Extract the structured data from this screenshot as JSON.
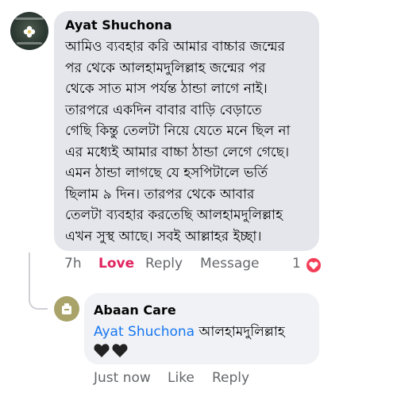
{
  "comment": {
    "author": "Ayat Shuchona",
    "body": "আমিও ব্যবহার করি আমার বাচ্চার জন্মের\nপর থেকে আলহামদুলিল্লাহ জন্মের পর\nথেকে সাত মাস পর্যন্ত ঠান্ডা লাগে নাই।\nতারপরে একদিন বাবার বাড়ি বেড়াতে\nগেছি কিন্তু তেলটা নিয়ে যেতে মনে ছিল না\nএর মধ্যেই আমার বাচ্চা ঠান্ডা লেগে গেছে।\nএমন ঠান্ডা লাগছে যে হসপিটালে ভর্তি\nছিলাম ৯ দিন। তারপর থেকে আবার\nতেলটা ব্যবহার করতেছি আলহামদুলিল্লাহ\nএখন সুস্থ আছে। সবই আল্লাহর ইচ্ছা।",
    "time": "7h",
    "love_label": "Love",
    "reply_label": "Reply",
    "message_label": "Message",
    "reaction_count": "1"
  },
  "reply": {
    "author": "Abaan Care",
    "mention": "Ayat Shuchona",
    "text": "আলহামদুলিল্লাহ",
    "time": "Just now",
    "like_label": "Like",
    "reply_label": "Reply"
  },
  "colors": {
    "love": "#e0245e",
    "mention": "#1877f2",
    "bubble": "#e4e6eb",
    "muted": "#65676b",
    "heart_badge": "#f33e58"
  },
  "icons": {
    "reaction": "heart-icon",
    "reply_emoji": "black-heart-icon"
  }
}
